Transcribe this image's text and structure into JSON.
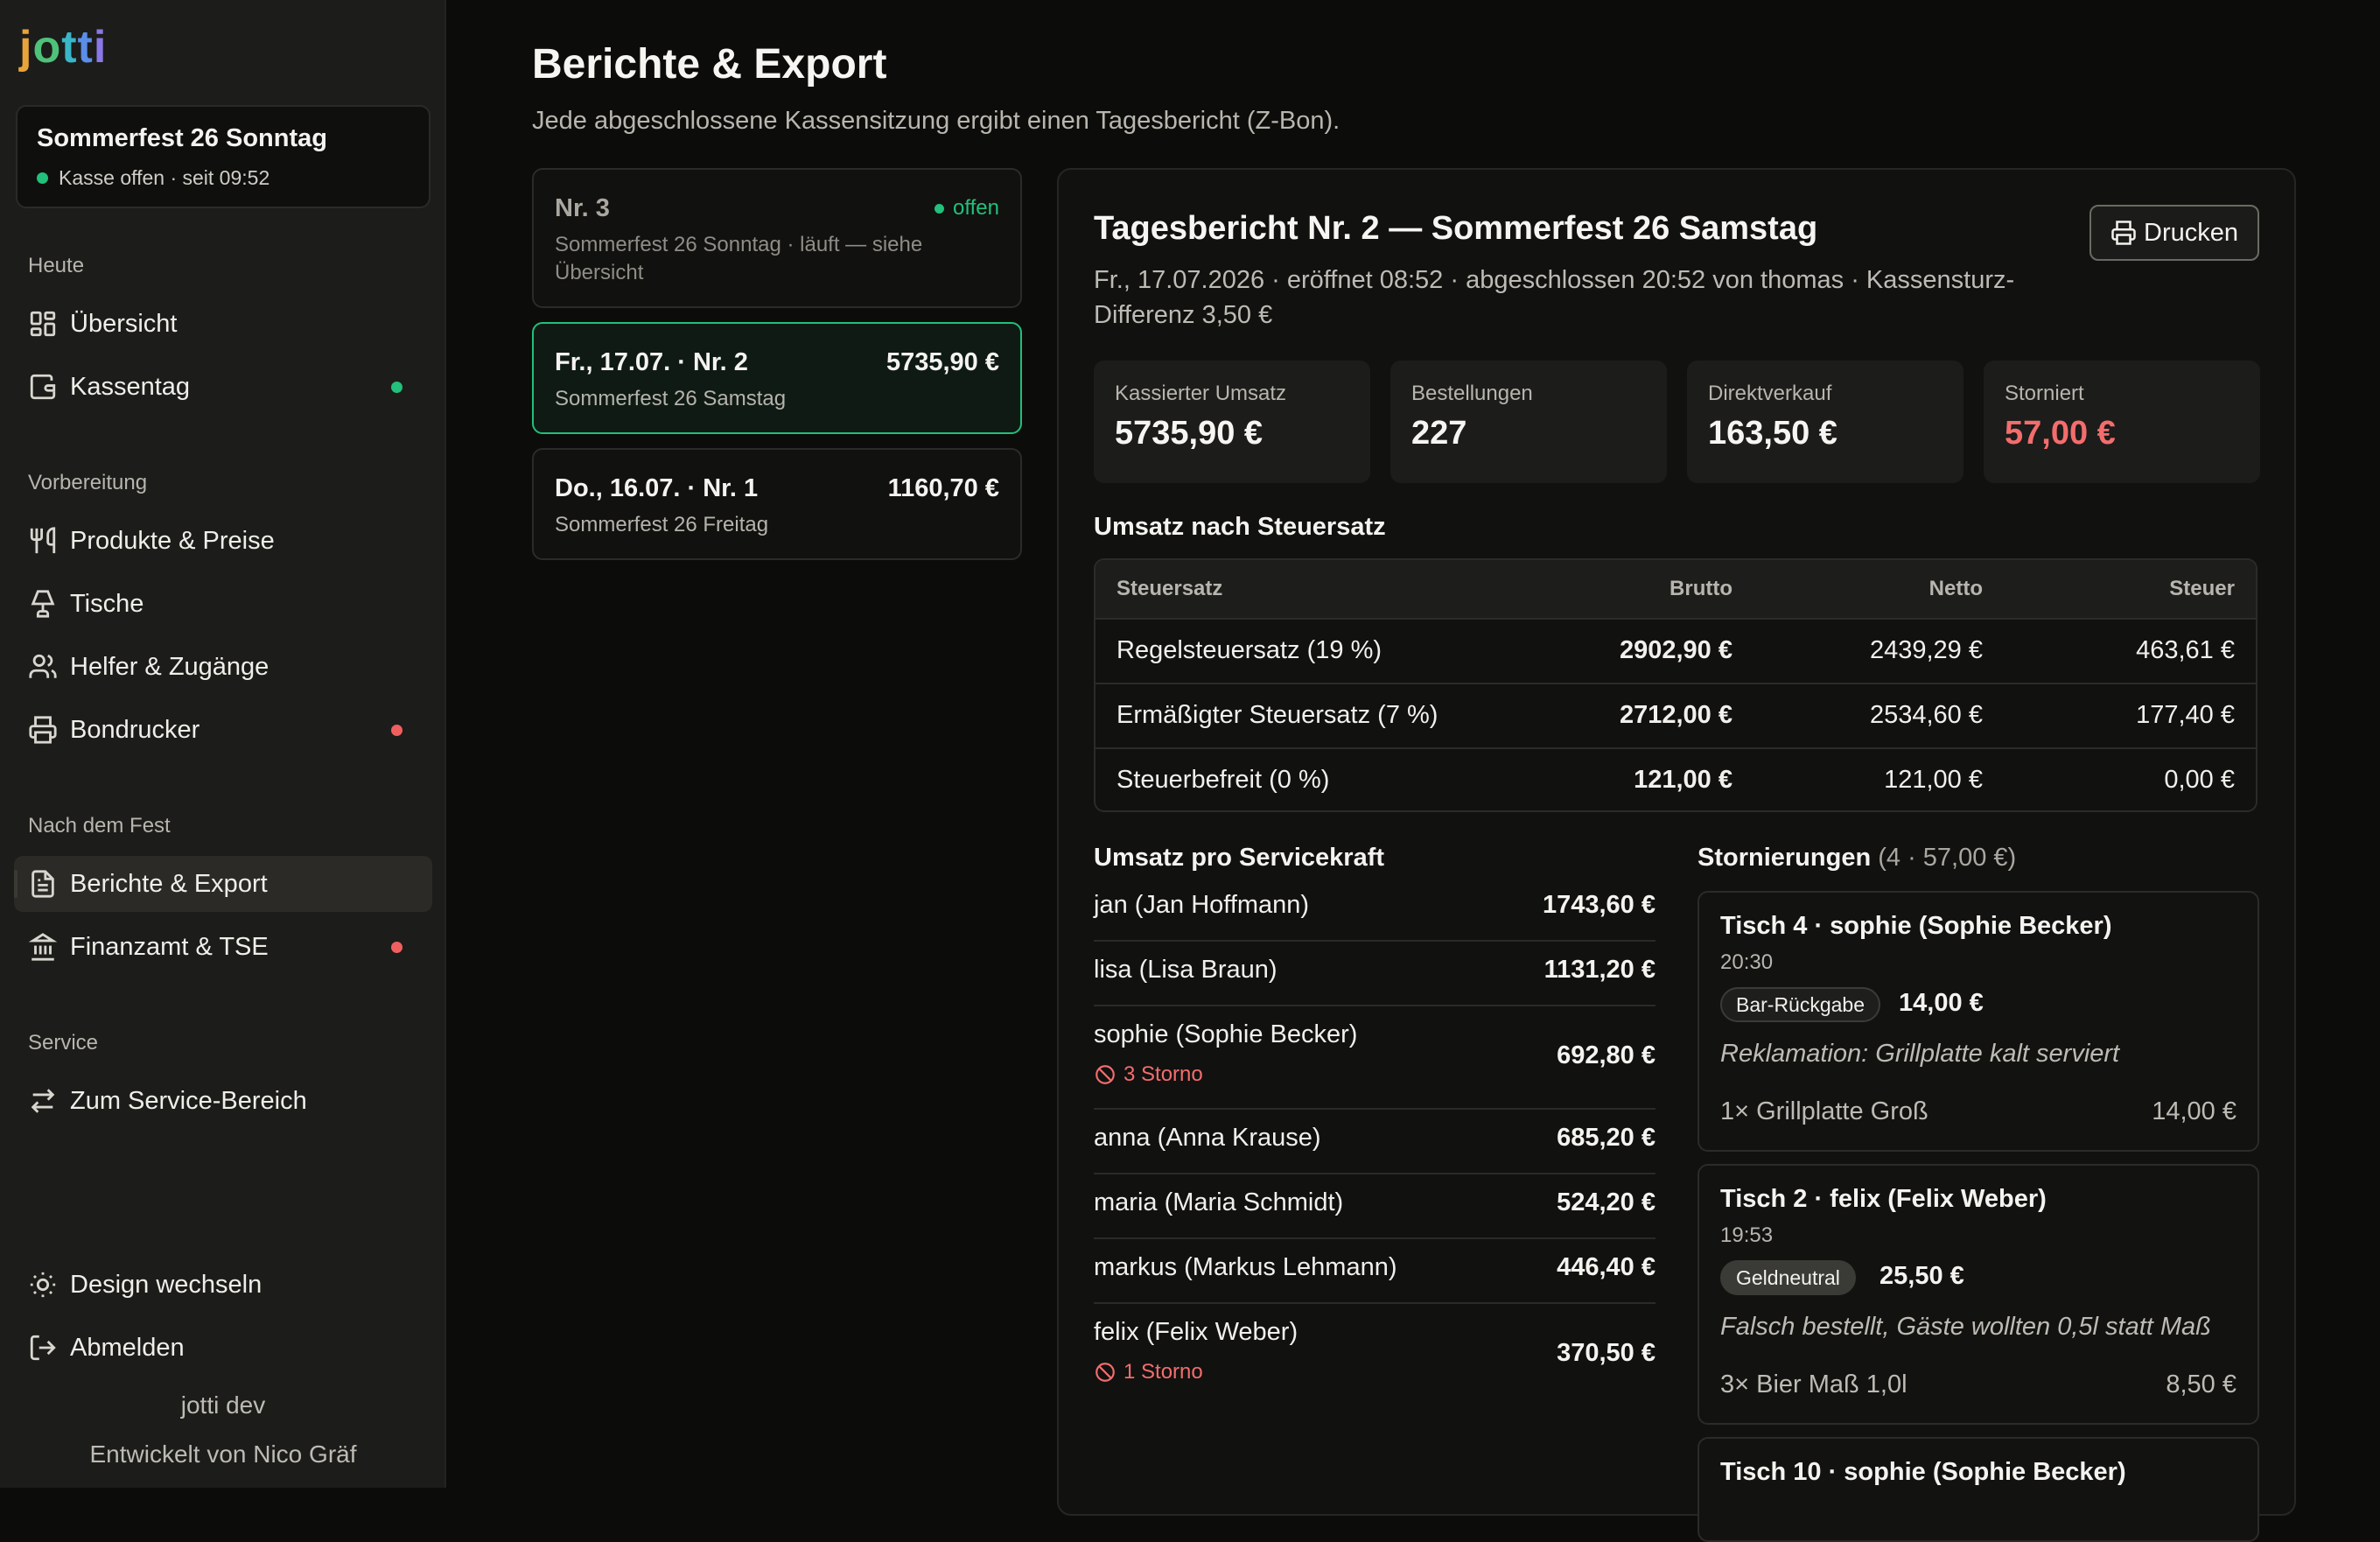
{
  "colors": {
    "accent": "#22c07a",
    "danger": "#f05f5f",
    "background": "#0c0c0b",
    "sidebar": "#1c1c1a"
  },
  "logo": [
    "j",
    "o",
    "t",
    "t",
    "i"
  ],
  "sidebar": {
    "event_title": "Sommerfest 26 Sonntag",
    "event_status": "Kasse offen · seit 09:52",
    "sections": {
      "heute": "Heute",
      "vorbereitung": "Vorbereitung",
      "nach_dem_fest": "Nach dem Fest",
      "service": "Service"
    },
    "items": [
      {
        "label": "Übersicht",
        "icon": "dashboard-icon"
      },
      {
        "label": "Kassentag",
        "icon": "cash-register-icon",
        "status": "green"
      },
      {
        "label": "Produkte & Preise",
        "icon": "utensils-icon"
      },
      {
        "label": "Tische",
        "icon": "lamp-icon"
      },
      {
        "label": "Helfer & Zugänge",
        "icon": "users-icon"
      },
      {
        "label": "Bondrucker",
        "icon": "printer-icon",
        "status": "red"
      },
      {
        "label": "Berichte & Export",
        "icon": "document-icon",
        "active": true
      },
      {
        "label": "Finanzamt & TSE",
        "icon": "bank-icon",
        "status": "red"
      },
      {
        "label": "Zum Service-Bereich",
        "icon": "swap-icon"
      },
      {
        "label": "Design wechseln",
        "icon": "sun-icon"
      },
      {
        "label": "Abmelden",
        "icon": "logout-icon"
      }
    ],
    "footer_version": "jotti dev",
    "footer_credit": "Entwickelt von Nico Gräf"
  },
  "main": {
    "title": "Berichte & Export",
    "subtitle": "Jede abgeschlossene Kassensitzung ergibt einen Tagesbericht (Z-Bon)."
  },
  "reports": [
    {
      "title": "Nr. 3",
      "status": "offen",
      "subtitle": "Sommerfest 26 Sonntag · läuft — siehe Übersicht"
    },
    {
      "title": "Fr., 17.07. · Nr. 2",
      "amount": "5735,90 €",
      "subtitle": "Sommerfest 26 Samstag",
      "selected": true
    },
    {
      "title": "Do., 16.07. · Nr. 1",
      "amount": "1160,70 €",
      "subtitle": "Sommerfest 26 Freitag"
    }
  ],
  "detail": {
    "title": "Tagesbericht Nr. 2 — Sommerfest 26 Samstag",
    "meta": "Fr., 17.07.2026 · eröffnet 08:52 · abgeschlossen 20:52 von thomas · Kassensturz-Differenz 3,50 €",
    "print_label": "Drucken",
    "stats": [
      {
        "label": "Kassierter Umsatz",
        "value": "5735,90 €"
      },
      {
        "label": "Bestellungen",
        "value": "227"
      },
      {
        "label": "Direktverkauf",
        "value": "163,50 €"
      },
      {
        "label": "Storniert",
        "value": "57,00 €",
        "negative": true
      }
    ],
    "tax_title": "Umsatz nach Steuersatz",
    "tax_headers": [
      "Steuersatz",
      "Brutto",
      "Netto",
      "Steuer"
    ],
    "tax_rows": [
      {
        "name": "Regelsteuersatz (19 %)",
        "brutto": "2902,90 €",
        "netto": "2439,29 €",
        "steuer": "463,61 €"
      },
      {
        "name": "Ermäßigter Steuersatz (7 %)",
        "brutto": "2712,00 €",
        "netto": "2534,60 €",
        "steuer": "177,40 €"
      },
      {
        "name": "Steuerbefreit (0 %)",
        "brutto": "121,00 €",
        "netto": "121,00 €",
        "steuer": "0,00 €"
      }
    ],
    "staff_title": "Umsatz pro Servicekraft",
    "staff": [
      {
        "name": "jan (Jan Hoffmann)",
        "amount": "1743,60 €"
      },
      {
        "name": "lisa (Lisa Braun)",
        "amount": "1131,20 €"
      },
      {
        "name": "sophie (Sophie Becker)",
        "amount": "692,80 €",
        "storno": "3 Storno"
      },
      {
        "name": "anna (Anna Krause)",
        "amount": "685,20 €"
      },
      {
        "name": "maria (Maria Schmidt)",
        "amount": "524,20 €"
      },
      {
        "name": "markus (Markus Lehmann)",
        "amount": "446,40 €"
      },
      {
        "name": "felix (Felix Weber)",
        "amount": "370,50 €",
        "storno": "1 Storno"
      }
    ],
    "voids_title": "Stornierungen",
    "voids_summary": "(4 · 57,00 €)",
    "voids": [
      {
        "header": "Tisch 4 · sophie (Sophie Becker)",
        "time": "20:30",
        "badge": "Bar-Rückgabe",
        "amount": "14,00 €",
        "reason": "Reklamation: Grillplatte kalt serviert",
        "item": "1× Grillplatte Groß",
        "item_price": "14,00 €"
      },
      {
        "header": "Tisch 2 · felix (Felix Weber)",
        "time": "19:53",
        "badge": "Geldneutral",
        "amount": "25,50 €",
        "reason": "Falsch bestellt, Gäste wollten 0,5l statt Maß",
        "item": "3× Bier Maß 1,0l",
        "item_price": "8,50 €"
      },
      {
        "header": "Tisch 10 · sophie (Sophie Becker)"
      }
    ]
  }
}
